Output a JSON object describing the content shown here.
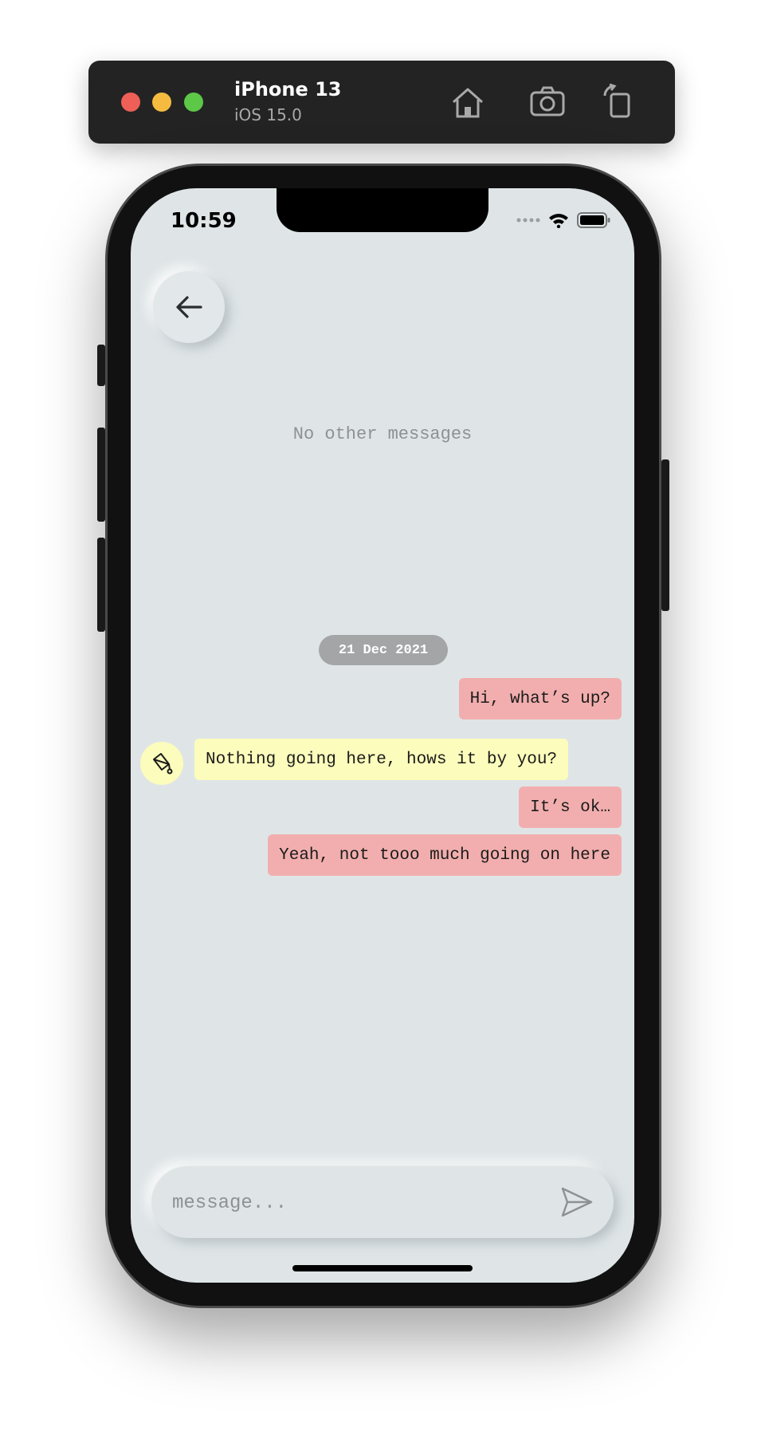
{
  "simulator": {
    "device_name": "iPhone 13",
    "os_version": "iOS 15.0",
    "buttons": [
      "home-icon",
      "camera-icon",
      "rotate-icon"
    ]
  },
  "status_bar": {
    "time": "10:59"
  },
  "chat": {
    "empty_note": "No other messages",
    "date_chip": "21 Dec 2021",
    "messages": [
      {
        "from": "me",
        "text": "Hi, what’s up?"
      },
      {
        "from": "them",
        "text": "Nothing going here, hows it by you?"
      },
      {
        "from": "me",
        "text": "It’s ok…"
      },
      {
        "from": "me",
        "text": "Yeah, not tooo much going on here"
      }
    ]
  },
  "composer": {
    "placeholder": "message..."
  },
  "colors": {
    "screen_bg": "#dfe5e7",
    "my_bubble": "#f2aeae",
    "their_bubble": "#fcfcbc",
    "date_chip": "#a3a5a7"
  }
}
